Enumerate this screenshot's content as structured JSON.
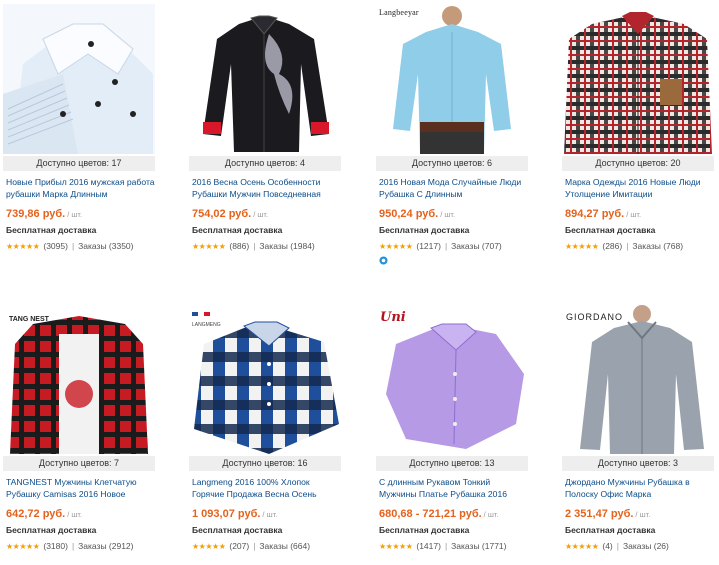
{
  "products": [
    {
      "colors": "Доступно цветов: 17",
      "title": "Новые Прибыл 2016 мужская работа рубашки Марка Длинным",
      "price": "739,86 руб.",
      "unit": "/ шт.",
      "shipping": "Бесплатная доставка",
      "reviews": "(3095)",
      "orders": "Заказы (3350)",
      "brand": ""
    },
    {
      "colors": "Доступно цветов: 4",
      "title": "2016 Весна Осень Особенности Рубашки Мужчин Повседневная",
      "price": "754,02 руб.",
      "unit": "/ шт.",
      "shipping": "Бесплатная доставка",
      "reviews": "(886)",
      "orders": "Заказы (1984)",
      "brand": ""
    },
    {
      "colors": "Доступно цветов: 6",
      "title": "2016 Новая Мода Случайные Люди Рубашка С Длинным",
      "price": "950,24 руб.",
      "unit": "/ шт.",
      "shipping": "Бесплатная доставка",
      "reviews": "(1217)",
      "orders": "Заказы (707)",
      "brand": "Langbeeyar"
    },
    {
      "colors": "Доступно цветов: 20",
      "title": "Марка Одежды 2016 Новые Люди Утолщение Имитации",
      "price": "894,27 руб.",
      "unit": "/ шт.",
      "shipping": "Бесплатная доставка",
      "reviews": "(286)",
      "orders": "Заказы (768)",
      "brand": ""
    },
    {
      "colors": "Доступно цветов: 7",
      "title": "TANGNEST Мужчины Клетчатую Рубашку Camisas 2016 Новое",
      "price": "642,72 руб.",
      "unit": "/ шт.",
      "shipping": "Бесплатная доставка",
      "reviews": "(3180)",
      "orders": "Заказы (2912)",
      "brand": "TANG NEST"
    },
    {
      "colors": "Доступно цветов: 16",
      "title": "Langmeng 2016 100% Хлопок Горячие Продажа Весна Осень",
      "price": "1 093,07 руб.",
      "unit": "/ шт.",
      "shipping": "Бесплатная доставка",
      "reviews": "(207)",
      "orders": "Заказы (664)",
      "brand": "LANGMENG"
    },
    {
      "colors": "Доступно цветов: 13",
      "title": "С длинным Рукавом Тонкий Мужчины Платье Рубашка 2016",
      "price": "680,68 - 721,21 руб.",
      "unit": "/ шт.",
      "shipping": "Бесплатная доставка",
      "reviews": "(1417)",
      "orders": "Заказы (1771)",
      "brand": "Uni"
    },
    {
      "colors": "Доступно цветов: 3",
      "title": "Джордано Мужчины Рубашка в Полоску Офис Марка",
      "price": "2 351,47 руб.",
      "unit": "/ шт.",
      "shipping": "Бесплатная доставка",
      "reviews": "(4)",
      "orders": "Заказы (26)",
      "brand": "GIORDANO"
    }
  ],
  "stars_glyph": "★★★★★",
  "separator": "|",
  "accent_color": "#e5621c",
  "link_color": "#0b4c8a",
  "star_color": "#f29f05",
  "mobile_icon": "mobile-deal-icon"
}
